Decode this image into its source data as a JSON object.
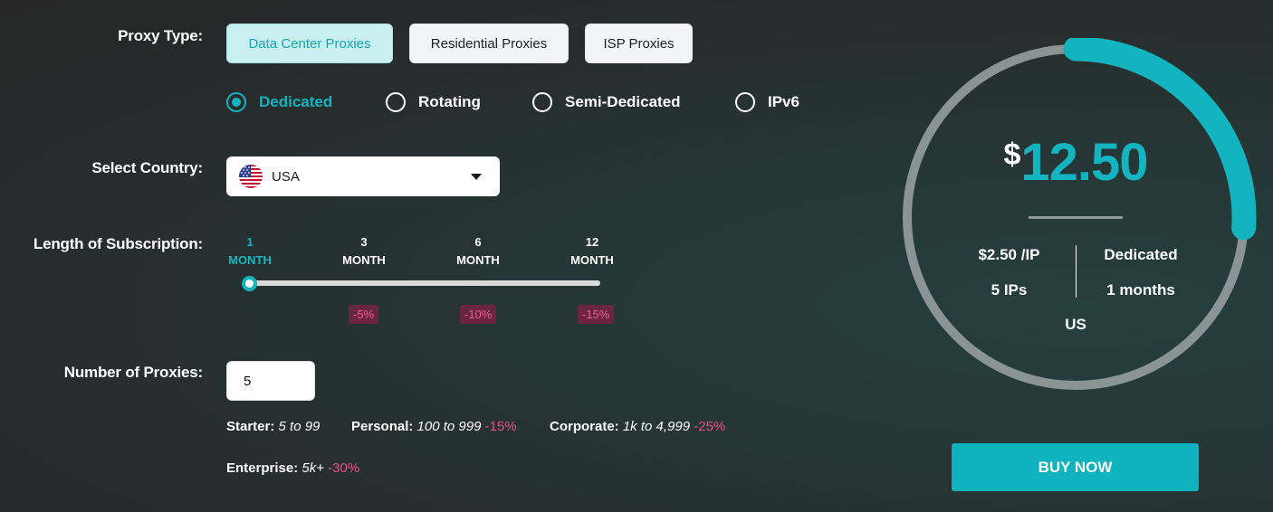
{
  "labels": {
    "proxy_type": "Proxy Type:",
    "select_country": "Select Country:",
    "length": "Length of Subscription:",
    "num_proxies": "Number of Proxies:"
  },
  "proxy_types": [
    {
      "label": "Data Center Proxies",
      "active": true
    },
    {
      "label": "Residential Proxies",
      "active": false
    },
    {
      "label": "ISP Proxies",
      "active": false
    }
  ],
  "modes": [
    {
      "label": "Dedicated",
      "selected": true
    },
    {
      "label": "Rotating",
      "selected": false
    },
    {
      "label": "Semi-Dedicated",
      "selected": false
    },
    {
      "label": "IPv6",
      "selected": false
    }
  ],
  "country": {
    "value": "USA",
    "flag_icon": "us-flag-icon"
  },
  "subscription": {
    "options": [
      {
        "num": "1",
        "unit": "MONTH",
        "discount": ""
      },
      {
        "num": "3",
        "unit": "MONTH",
        "discount": "-5%"
      },
      {
        "num": "6",
        "unit": "MONTH",
        "discount": "-10%"
      },
      {
        "num": "12",
        "unit": "MONTH",
        "discount": "-15%"
      }
    ],
    "selected_index": 0
  },
  "proxies": {
    "value": "5"
  },
  "tiers": {
    "starter": {
      "name": "Starter:",
      "range": "5 to 99",
      "discount": ""
    },
    "personal": {
      "name": "Personal:",
      "range": "100 to 999",
      "discount": "-15%"
    },
    "corporate": {
      "name": "Corporate:",
      "range": "1k to 4,999",
      "discount": "-25%"
    },
    "enterprise": {
      "name": "Enterprise:",
      "range": "5k+",
      "discount": "-30%"
    }
  },
  "summary": {
    "currency": "$",
    "price": "12.50",
    "per_ip": "$2.50 /IP",
    "mode": "Dedicated",
    "ips": "5 IPs",
    "months": "1 months",
    "country": "US",
    "progress_fraction": 0.26
  },
  "buy_label": "BUY NOW",
  "colors": {
    "accent": "#12b5bf",
    "discount_text": "#ea4f8a",
    "discount_bg": "#6c2541",
    "ring_track": "#8a9494"
  }
}
